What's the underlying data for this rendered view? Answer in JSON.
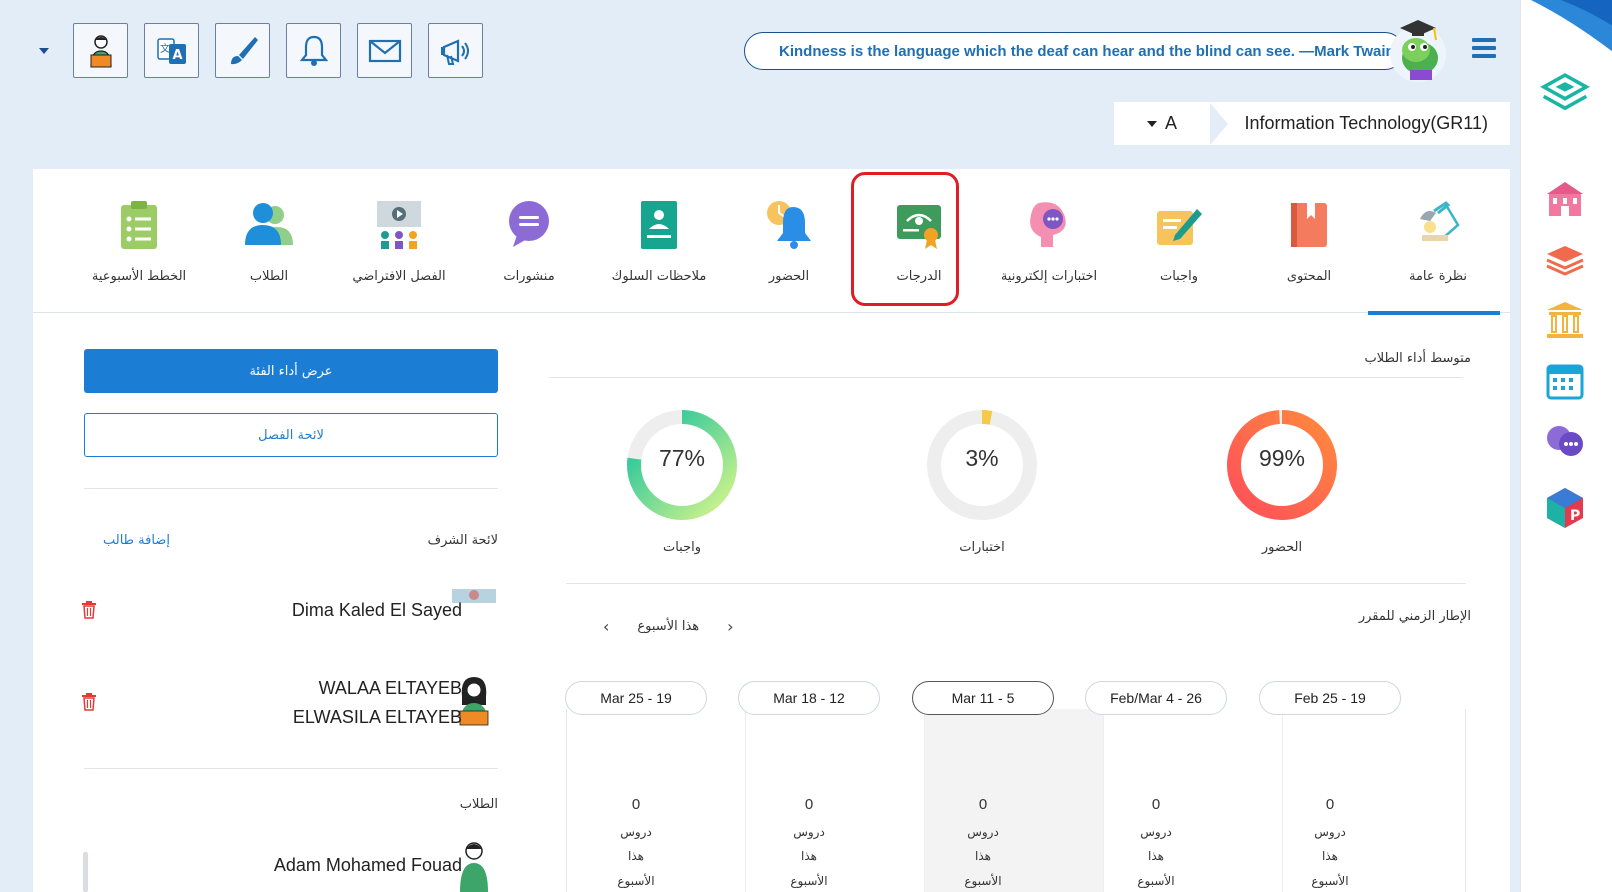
{
  "quote": {
    "text": "Kindness is the language which the deaf can hear and the blind can see. —Mark Twain"
  },
  "course": {
    "name": "Information Technology(GR11)",
    "section": "A"
  },
  "toolbar": {
    "icons": [
      "student-profile-icon",
      "translate-icon",
      "paint-brush-icon",
      "bell-icon",
      "envelope-icon",
      "megaphone-icon"
    ]
  },
  "tabs": [
    {
      "label": "نظرة عامة",
      "icon": "overview-lamp-icon",
      "active": true
    },
    {
      "label": "المحتوى",
      "icon": "content-book-icon"
    },
    {
      "label": "واجبات",
      "icon": "assignments-pen-icon"
    },
    {
      "label": "اختبارات إلكترونية",
      "icon": "quiz-chat-icon"
    },
    {
      "label": "الدرجات",
      "icon": "grades-certificate-icon",
      "highlighted": true
    },
    {
      "label": "الحضور",
      "icon": "attendance-bell-icon"
    },
    {
      "label": "ملاحظات السلوك",
      "icon": "behavior-notes-icon"
    },
    {
      "label": "منشورات",
      "icon": "posts-speech-icon"
    },
    {
      "label": "الفصل الافتراضي",
      "icon": "virtual-class-icon"
    },
    {
      "label": "الطلاب",
      "icon": "students-icon"
    },
    {
      "label": "الخطط الأسبوعية",
      "icon": "weekly-plans-icon"
    }
  ],
  "performance": {
    "title": "متوسط أداء الطلاب",
    "donuts": [
      {
        "label": "الحضور",
        "value": 99,
        "display": "99%"
      },
      {
        "label": "اختبارات",
        "value": 3,
        "display": "3%"
      },
      {
        "label": "واجبات",
        "value": 77,
        "display": "77%"
      }
    ]
  },
  "timeline": {
    "title": "الإطار الزمني للمقرر",
    "nav_label": "هذا الأسبوع",
    "weeks": [
      {
        "range": "Feb 25 - 19",
        "count": "0",
        "current": false
      },
      {
        "range": "Feb/Mar 4 - 26",
        "count": "0",
        "current": false
      },
      {
        "range": "Mar 11 - 5",
        "count": "0",
        "current": true
      },
      {
        "range": "Mar 18 - 12",
        "count": "0",
        "current": false
      },
      {
        "range": "Mar 25 - 19",
        "count": "0",
        "current": false
      }
    ],
    "line1": "دروس",
    "line2": "هذا",
    "line3": "الأسبوع"
  },
  "left_panel": {
    "class_performance_button": "عرض أداء الفئة",
    "class_roster_button": "لائحة الفصل",
    "honor_list_title": "لائحة الشرف",
    "add_student_link": "إضافة طالب",
    "honor_students": [
      {
        "name": "Dima Kaled El Sayed"
      },
      {
        "name_line1": "WALAA ELTAYEB",
        "name_line2": "ELWASILA ELTAYEB"
      }
    ],
    "students_title": "الطلاب",
    "students": [
      {
        "name": "Adam Mohamed Fouad"
      }
    ]
  },
  "colors": {
    "primary": "#1b7ed4",
    "highlight": "#e01c24",
    "attendance": "#ff5a4e",
    "quizzes": "#f7c948",
    "assignments": "#16c1a0"
  }
}
